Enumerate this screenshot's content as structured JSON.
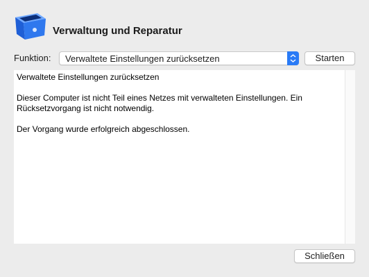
{
  "window": {
    "title": "Verwaltung und Reparatur",
    "app_icon": "blue-toolbox-icon"
  },
  "function_row": {
    "label": "Funktion:",
    "selected_option": "Verwaltete Einstellungen zurücksetzen",
    "start_button": "Starten"
  },
  "output": {
    "lines": [
      "Verwaltete Einstellungen zurücksetzen",
      "Dieser Computer ist nicht Teil eines Netzes mit verwalteten Einstellungen. Ein Rücksetzvorgang ist nicht notwendig.",
      "Der Vorgang wurde erfolgreich abgeschlossen."
    ]
  },
  "footer": {
    "close_button": "Schließen"
  },
  "colors": {
    "accent": "#2a7bf6",
    "icon_blue": "#1f5fd6",
    "background": "#ececec"
  }
}
